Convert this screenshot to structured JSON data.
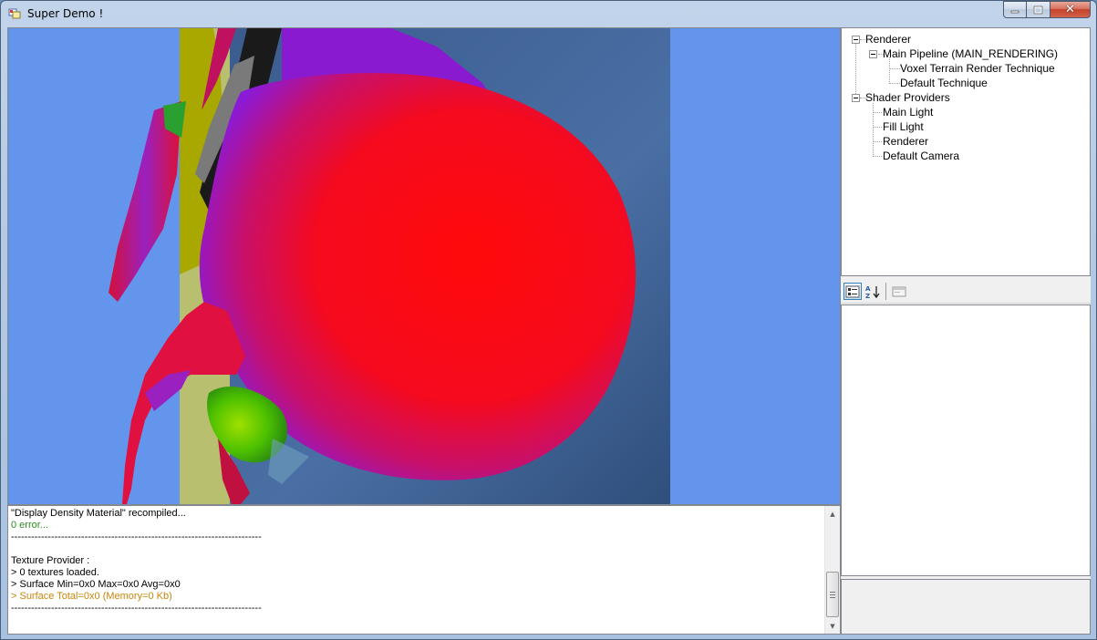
{
  "window": {
    "title": "Super Demo !"
  },
  "console": {
    "lines": [
      {
        "text": "\"Display Density Material\" recompiled...",
        "color": "black"
      },
      {
        "text": "0 error...",
        "color": "green"
      },
      {
        "text": "---------------------------------------------------------------------------",
        "color": "black"
      },
      {
        "text": "",
        "color": "black"
      },
      {
        "text": "Texture Provider :",
        "color": "black"
      },
      {
        "text": "> 0 textures loaded.",
        "color": "black"
      },
      {
        "text": "> Surface Min=0x0 Max=0x0 Avg=0x0",
        "color": "black"
      },
      {
        "text": "> Surface Total=0x0 (Memory=0 Kb)",
        "color": "orange"
      },
      {
        "text": "---------------------------------------------------------------------------",
        "color": "black"
      }
    ]
  },
  "tree": {
    "renderer": "Renderer",
    "main_pipeline": "Main Pipeline (MAIN_RENDERING)",
    "voxel_technique": "Voxel Terrain Render Technique",
    "default_technique": "Default Technique",
    "shader_providers": "Shader Providers",
    "main_light": "Main Light",
    "fill_light": "Fill Light",
    "renderer_child": "Renderer",
    "default_camera": "Default Camera"
  },
  "colors": {
    "viewport_bg": "#6495ed",
    "console_green": "#2e8b20",
    "console_orange": "#c8860a"
  }
}
